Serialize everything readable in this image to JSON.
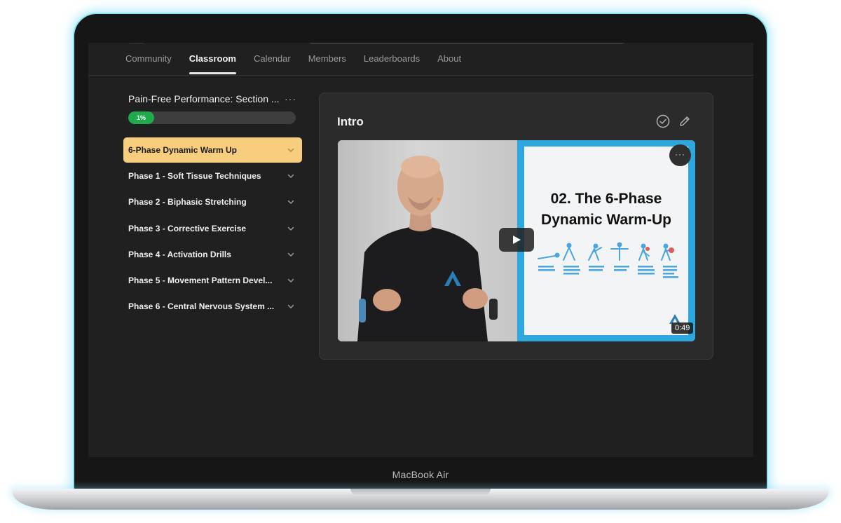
{
  "device": {
    "brand": "MacBook Air"
  },
  "nav": {
    "tabs": [
      {
        "label": "Community"
      },
      {
        "label": "Classroom"
      },
      {
        "label": "Calendar"
      },
      {
        "label": "Members"
      },
      {
        "label": "Leaderboards"
      },
      {
        "label": "About"
      }
    ],
    "active_tab": "Classroom"
  },
  "course": {
    "title": "Pain-Free Performance: Section ...",
    "more": "···",
    "progress_label": "1%",
    "progress_value": 1
  },
  "modules": [
    {
      "label": "6-Phase Dynamic Warm Up"
    },
    {
      "label": "Phase 1 - Soft Tissue Techniques"
    },
    {
      "label": "Phase 2 - Biphasic Stretching"
    },
    {
      "label": "Phase 3 - Corrective Exercise"
    },
    {
      "label": "Phase 4 - Activation Drills"
    },
    {
      "label": "Phase 5 - Movement Pattern Devel..."
    },
    {
      "label": "Phase 6 - Central Nervous System ..."
    }
  ],
  "lesson": {
    "title": "Intro",
    "video": {
      "more": "···",
      "duration": "0:49",
      "slide_title_line1": "02. The 6-Phase",
      "slide_title_line2": "Dynamic Warm-Up"
    }
  },
  "colors": {
    "accent": "#f7cd7e",
    "progress": "#1faa4c",
    "slide_border": "#2ea7df",
    "glow": "#8fe3f5"
  },
  "icons": {
    "check": "check-circle-icon",
    "edit": "pencil-icon",
    "play": "play-icon",
    "chevron": "chevron-down-icon"
  }
}
